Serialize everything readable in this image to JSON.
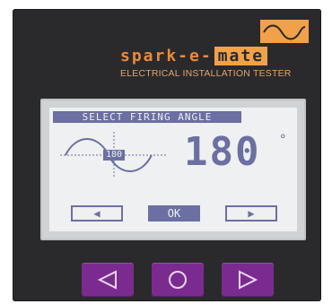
{
  "brand": {
    "name_prefix": "spark-e-",
    "name_box": "mate",
    "subtitle": "ELECTRICAL INSTALLATION TESTER",
    "accent_color": "#f1a14a"
  },
  "lcd": {
    "title": "SELECT FIRING ANGLE",
    "wave_marker": "180",
    "angle_value": "180",
    "angle_unit": "°",
    "buttons": {
      "left_symbol": "◀",
      "ok_label": "OK",
      "right_symbol": "▶"
    },
    "lcd_color": "#6c6fa2"
  },
  "physical_buttons": {
    "left_icon": "triangle-left-icon",
    "center_icon": "circle-icon",
    "right_icon": "triangle-right-icon",
    "color": "#7b2b8f"
  }
}
